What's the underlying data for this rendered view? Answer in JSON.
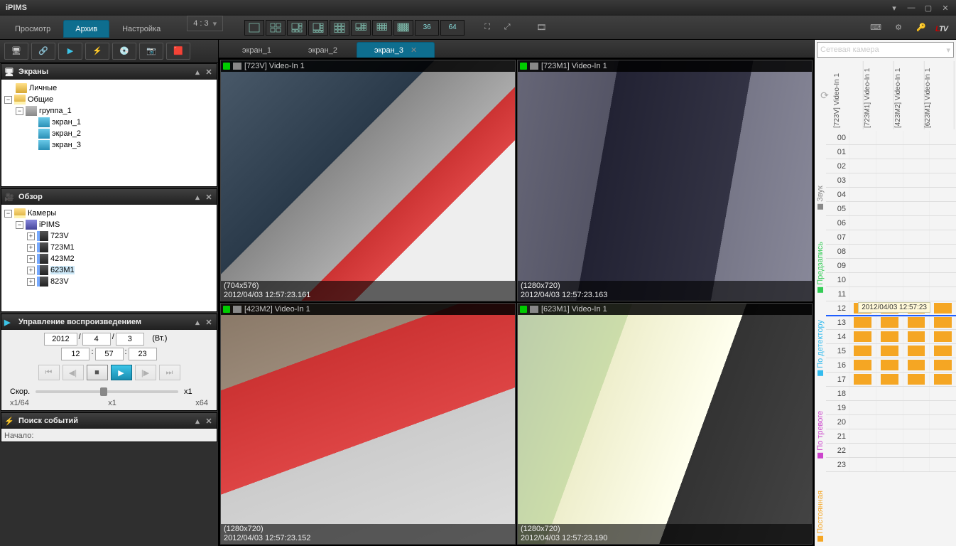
{
  "app_title": "iPIMS",
  "main_tabs": {
    "view": "Просмотр",
    "archive": "Архив",
    "settings": "Настройка",
    "active": "archive"
  },
  "aspect_ratio": "4 : 3",
  "layout_text_buttons": [
    "36",
    "64"
  ],
  "logo": "LTV",
  "sidebar": {
    "panel_screens": "Экраны",
    "panel_overview": "Обзор",
    "panel_playback": "Управление воспроизведением",
    "panel_search": "Поиск событий",
    "search_field_label": "Начало:",
    "screens_tree": {
      "personal": "Личные",
      "shared": "Общие",
      "group": "группа_1",
      "items": [
        "экран_1",
        "экран_2",
        "экран_3"
      ]
    },
    "overview_tree": {
      "root": "Камеры",
      "node": "iPIMS",
      "cams": [
        "723V",
        "723M1",
        "423M2",
        "623M1",
        "823V"
      ],
      "selected": "623M1"
    },
    "date": {
      "y": "2012",
      "m": "4",
      "d": "3",
      "dow": "(Вт.)"
    },
    "time": {
      "h": "12",
      "mi": "57",
      "s": "23"
    },
    "speed_label": "Скор.",
    "speed_marks": [
      "x1/64",
      "x1",
      "x64"
    ],
    "speed_btn": "x1"
  },
  "screen_tabs": {
    "items": [
      "экран_1",
      "экран_2",
      "экран_3"
    ],
    "active": 2
  },
  "cells": [
    {
      "name": "[723V] Video-In 1",
      "res": "(704x576)",
      "ts": "2012/04/03 12:57:23.161"
    },
    {
      "name": "[723M1] Video-In 1",
      "res": "(1280x720)",
      "ts": "2012/04/03 12:57:23.163"
    },
    {
      "name": "[423M2] Video-In 1",
      "res": "(1280x720)",
      "ts": "2012/04/03 12:57:23.152"
    },
    {
      "name": "[623M1] Video-In 1",
      "res": "(1280x720)",
      "ts": "2012/04/03 12:57:23.190"
    }
  ],
  "rpanel": {
    "dropdown": "Сетевая камера",
    "cam_cols": [
      "[723V] Video-In 1",
      "[723M1] Video-In 1",
      "[423M2] Video-In 1",
      "[623M1] Video-In 1"
    ],
    "hours": [
      "00",
      "01",
      "02",
      "03",
      "04",
      "05",
      "06",
      "07",
      "08",
      "09",
      "10",
      "11",
      "12",
      "13",
      "14",
      "15",
      "16",
      "17",
      "18",
      "19",
      "20",
      "21",
      "22",
      "23"
    ],
    "cursor_label": "2012/04/03 12:57:23",
    "legend": [
      {
        "label": "Звук",
        "color": "#888"
      },
      {
        "label": "Предзапись",
        "color": "#33cc55"
      },
      {
        "label": "По детектору",
        "color": "#33bbee"
      },
      {
        "label": "По тревоге",
        "color": "#cc44cc"
      },
      {
        "label": "Постоянная",
        "color": "#f5a623"
      }
    ],
    "data_hours": [
      12,
      13,
      14,
      15,
      16,
      17
    ]
  }
}
